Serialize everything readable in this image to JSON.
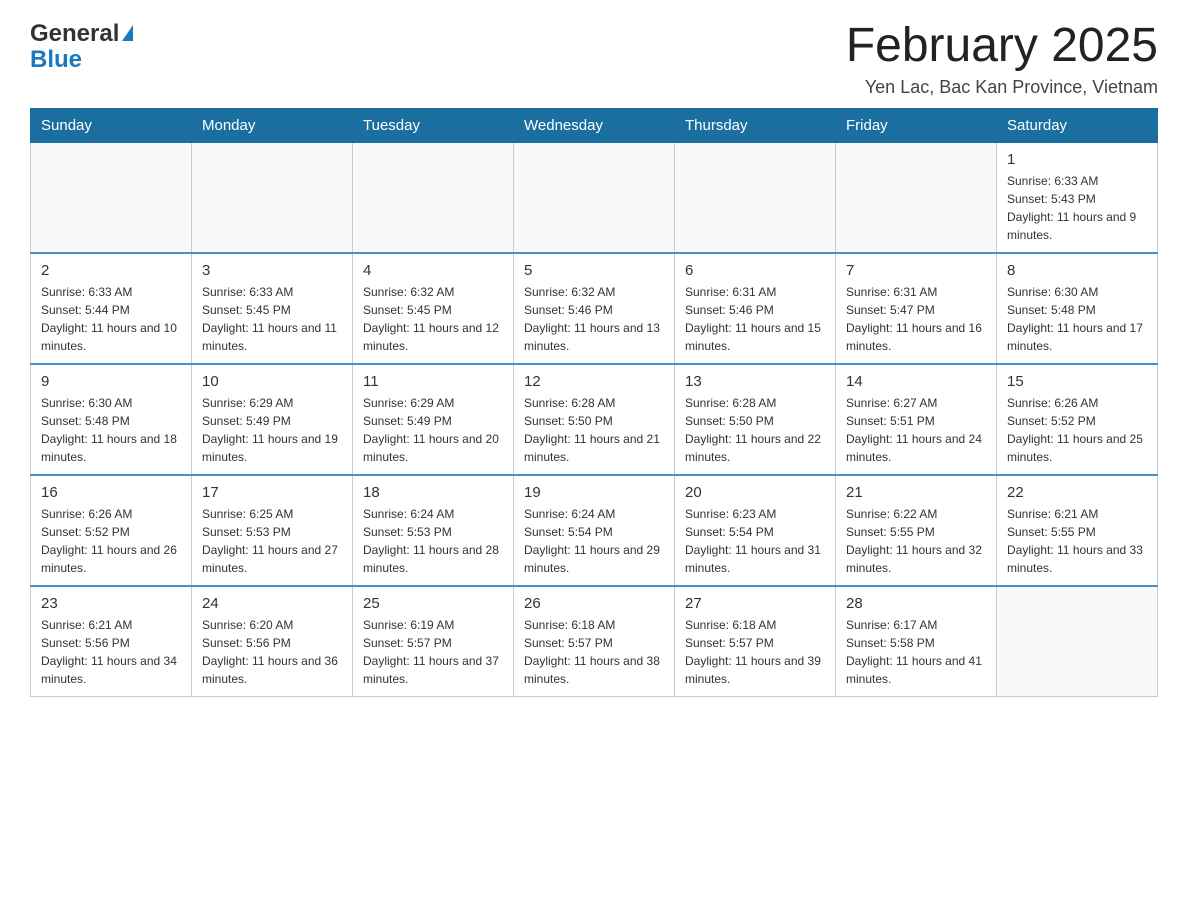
{
  "header": {
    "logo_general": "General",
    "logo_blue": "Blue",
    "month_title": "February 2025",
    "location": "Yen Lac, Bac Kan Province, Vietnam"
  },
  "weekdays": [
    "Sunday",
    "Monday",
    "Tuesday",
    "Wednesday",
    "Thursday",
    "Friday",
    "Saturday"
  ],
  "weeks": [
    [
      {
        "day": "",
        "info": ""
      },
      {
        "day": "",
        "info": ""
      },
      {
        "day": "",
        "info": ""
      },
      {
        "day": "",
        "info": ""
      },
      {
        "day": "",
        "info": ""
      },
      {
        "day": "",
        "info": ""
      },
      {
        "day": "1",
        "info": "Sunrise: 6:33 AM\nSunset: 5:43 PM\nDaylight: 11 hours and 9 minutes."
      }
    ],
    [
      {
        "day": "2",
        "info": "Sunrise: 6:33 AM\nSunset: 5:44 PM\nDaylight: 11 hours and 10 minutes."
      },
      {
        "day": "3",
        "info": "Sunrise: 6:33 AM\nSunset: 5:45 PM\nDaylight: 11 hours and 11 minutes."
      },
      {
        "day": "4",
        "info": "Sunrise: 6:32 AM\nSunset: 5:45 PM\nDaylight: 11 hours and 12 minutes."
      },
      {
        "day": "5",
        "info": "Sunrise: 6:32 AM\nSunset: 5:46 PM\nDaylight: 11 hours and 13 minutes."
      },
      {
        "day": "6",
        "info": "Sunrise: 6:31 AM\nSunset: 5:46 PM\nDaylight: 11 hours and 15 minutes."
      },
      {
        "day": "7",
        "info": "Sunrise: 6:31 AM\nSunset: 5:47 PM\nDaylight: 11 hours and 16 minutes."
      },
      {
        "day": "8",
        "info": "Sunrise: 6:30 AM\nSunset: 5:48 PM\nDaylight: 11 hours and 17 minutes."
      }
    ],
    [
      {
        "day": "9",
        "info": "Sunrise: 6:30 AM\nSunset: 5:48 PM\nDaylight: 11 hours and 18 minutes."
      },
      {
        "day": "10",
        "info": "Sunrise: 6:29 AM\nSunset: 5:49 PM\nDaylight: 11 hours and 19 minutes."
      },
      {
        "day": "11",
        "info": "Sunrise: 6:29 AM\nSunset: 5:49 PM\nDaylight: 11 hours and 20 minutes."
      },
      {
        "day": "12",
        "info": "Sunrise: 6:28 AM\nSunset: 5:50 PM\nDaylight: 11 hours and 21 minutes."
      },
      {
        "day": "13",
        "info": "Sunrise: 6:28 AM\nSunset: 5:50 PM\nDaylight: 11 hours and 22 minutes."
      },
      {
        "day": "14",
        "info": "Sunrise: 6:27 AM\nSunset: 5:51 PM\nDaylight: 11 hours and 24 minutes."
      },
      {
        "day": "15",
        "info": "Sunrise: 6:26 AM\nSunset: 5:52 PM\nDaylight: 11 hours and 25 minutes."
      }
    ],
    [
      {
        "day": "16",
        "info": "Sunrise: 6:26 AM\nSunset: 5:52 PM\nDaylight: 11 hours and 26 minutes."
      },
      {
        "day": "17",
        "info": "Sunrise: 6:25 AM\nSunset: 5:53 PM\nDaylight: 11 hours and 27 minutes."
      },
      {
        "day": "18",
        "info": "Sunrise: 6:24 AM\nSunset: 5:53 PM\nDaylight: 11 hours and 28 minutes."
      },
      {
        "day": "19",
        "info": "Sunrise: 6:24 AM\nSunset: 5:54 PM\nDaylight: 11 hours and 29 minutes."
      },
      {
        "day": "20",
        "info": "Sunrise: 6:23 AM\nSunset: 5:54 PM\nDaylight: 11 hours and 31 minutes."
      },
      {
        "day": "21",
        "info": "Sunrise: 6:22 AM\nSunset: 5:55 PM\nDaylight: 11 hours and 32 minutes."
      },
      {
        "day": "22",
        "info": "Sunrise: 6:21 AM\nSunset: 5:55 PM\nDaylight: 11 hours and 33 minutes."
      }
    ],
    [
      {
        "day": "23",
        "info": "Sunrise: 6:21 AM\nSunset: 5:56 PM\nDaylight: 11 hours and 34 minutes."
      },
      {
        "day": "24",
        "info": "Sunrise: 6:20 AM\nSunset: 5:56 PM\nDaylight: 11 hours and 36 minutes."
      },
      {
        "day": "25",
        "info": "Sunrise: 6:19 AM\nSunset: 5:57 PM\nDaylight: 11 hours and 37 minutes."
      },
      {
        "day": "26",
        "info": "Sunrise: 6:18 AM\nSunset: 5:57 PM\nDaylight: 11 hours and 38 minutes."
      },
      {
        "day": "27",
        "info": "Sunrise: 6:18 AM\nSunset: 5:57 PM\nDaylight: 11 hours and 39 minutes."
      },
      {
        "day": "28",
        "info": "Sunrise: 6:17 AM\nSunset: 5:58 PM\nDaylight: 11 hours and 41 minutes."
      },
      {
        "day": "",
        "info": ""
      }
    ]
  ]
}
